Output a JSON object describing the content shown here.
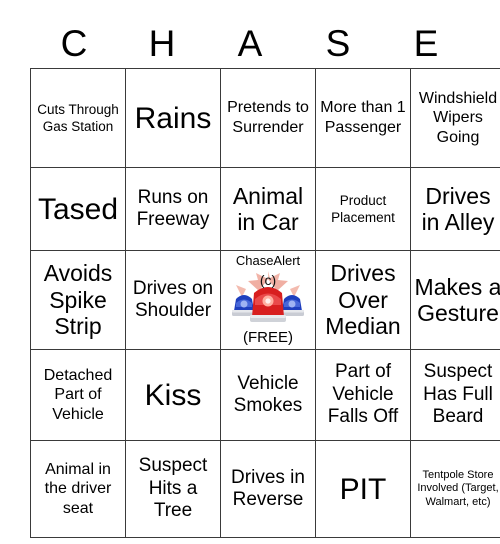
{
  "card": {
    "header_letters": [
      "C",
      "H",
      "A",
      "S",
      "E"
    ],
    "rows": [
      [
        {
          "text": "Cuts Through Gas Station",
          "size": "t-sm"
        },
        {
          "text": "Rains",
          "size": "t-xxl"
        },
        {
          "text": "Pretends to Surrender",
          "size": "t-md"
        },
        {
          "text": "More than 1 Passenger",
          "size": "t-md"
        },
        {
          "text": "Windshield Wipers Going",
          "size": "t-md"
        }
      ],
      [
        {
          "text": "Tased",
          "size": "t-xxl"
        },
        {
          "text": "Runs on Freeway",
          "size": "t-lg"
        },
        {
          "text": "Animal in Car",
          "size": "t-xl"
        },
        {
          "text": "Product Placement",
          "size": "t-sm"
        },
        {
          "text": "Drives in Alley",
          "size": "t-xl"
        }
      ],
      [
        {
          "text": "Avoids Spike Strip",
          "size": "t-xl"
        },
        {
          "text": "Drives on Shoulder",
          "size": "t-lg"
        },
        {
          "text": "FREE_SPACE",
          "size": "free"
        },
        {
          "text": "Drives Over Median",
          "size": "t-xl"
        },
        {
          "text": "Makes a Gesture",
          "size": "t-xl"
        }
      ],
      [
        {
          "text": "Detached Part of Vehicle",
          "size": "t-md"
        },
        {
          "text": "Kiss",
          "size": "t-xxl"
        },
        {
          "text": "Vehicle Smokes",
          "size": "t-lg"
        },
        {
          "text": "Part of Vehicle Falls Off",
          "size": "t-lg"
        },
        {
          "text": "Suspect Has Full Beard",
          "size": "t-lg"
        }
      ],
      [
        {
          "text": "Animal in the driver seat",
          "size": "t-md"
        },
        {
          "text": "Suspect Hits a Tree",
          "size": "t-lg"
        },
        {
          "text": "Drives in Reverse",
          "size": "t-lg"
        },
        {
          "text": "PIT",
          "size": "t-xxl"
        },
        {
          "text": "Tentpole Store Involved (Target, Walmart, etc)",
          "size": "t-xs"
        }
      ]
    ],
    "free_space": {
      "title": "ChaseAlert",
      "copyright": "(c)",
      "label": "(FREE)",
      "icon": "police-lightbar-icon",
      "colors": {
        "red_dome": "#d81f1f",
        "blue_dome": "#1f3fbe",
        "flare": "#f0a79a",
        "base": "#dadde2"
      }
    }
  }
}
